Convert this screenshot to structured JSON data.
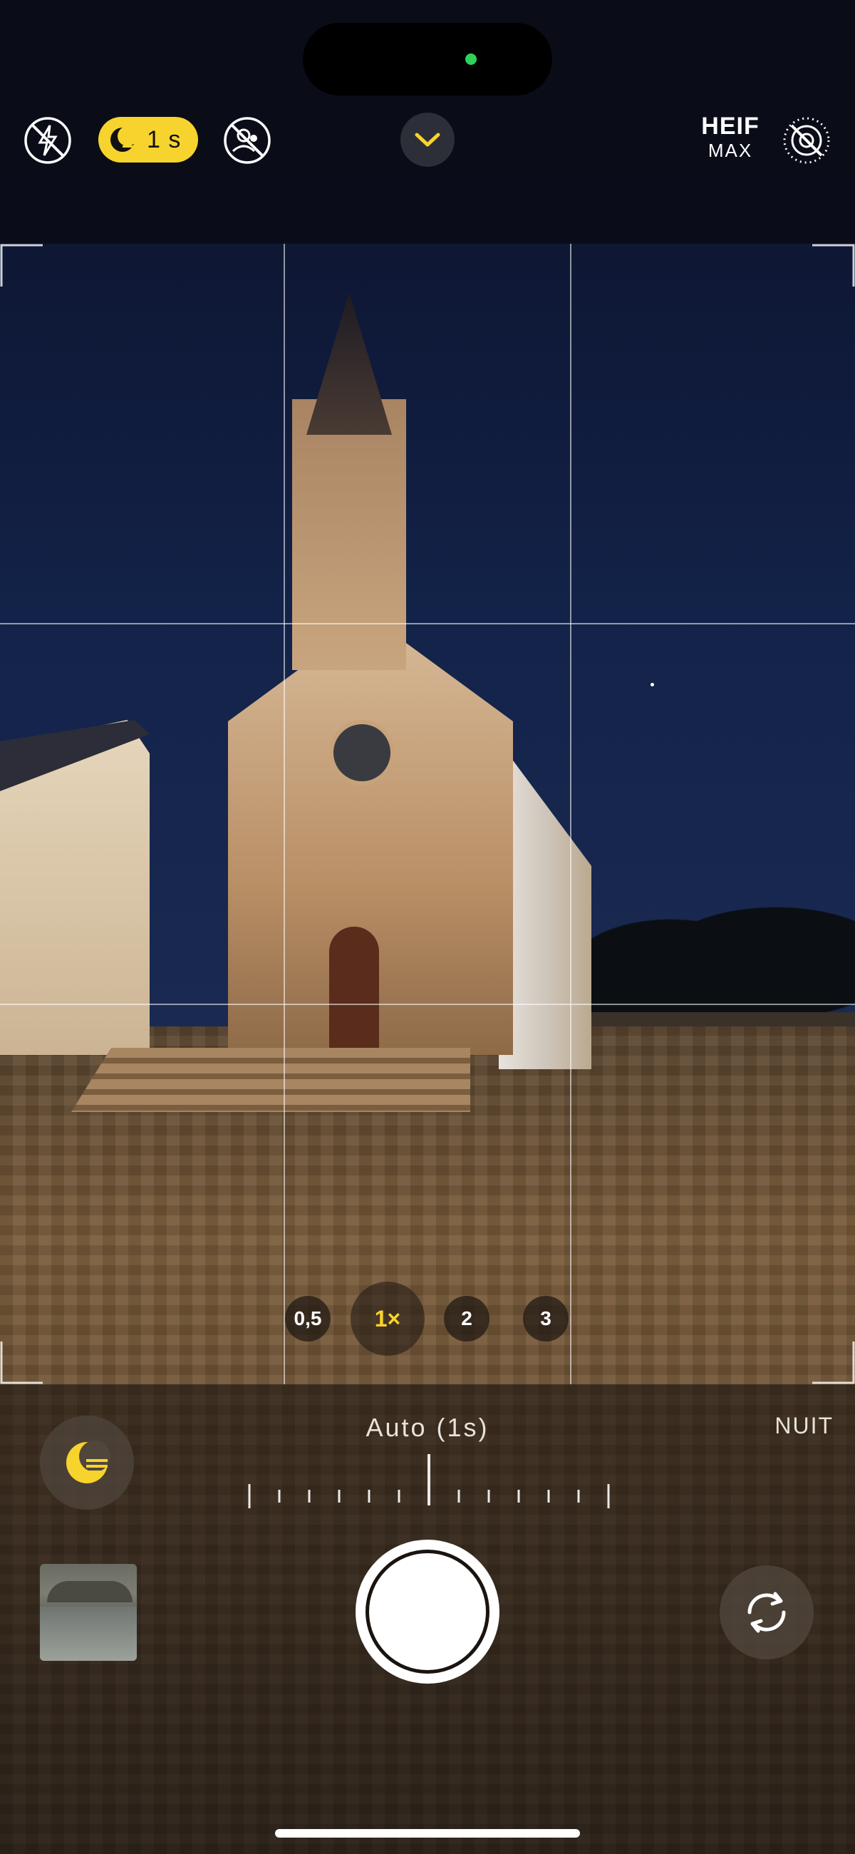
{
  "top_bar": {
    "night_mode_label": "1 s",
    "format_primary": "HEIF",
    "format_secondary": "MAX"
  },
  "zoom": {
    "options": [
      "0,5",
      "1×",
      "2",
      "3"
    ],
    "selected": "1×"
  },
  "night_mode": {
    "exposure_label": "Auto (1s)",
    "mode_label": "NUIT"
  },
  "colors": {
    "accent_yellow": "#f7d32d",
    "camera_active_dot": "#2fd158"
  },
  "icons": {
    "flash": "flash-off-icon",
    "night": "night-mode-icon",
    "portrait": "portrait-off-icon",
    "chevron": "chevron-down-icon",
    "live": "live-photo-off-icon",
    "flip": "camera-flip-icon"
  }
}
